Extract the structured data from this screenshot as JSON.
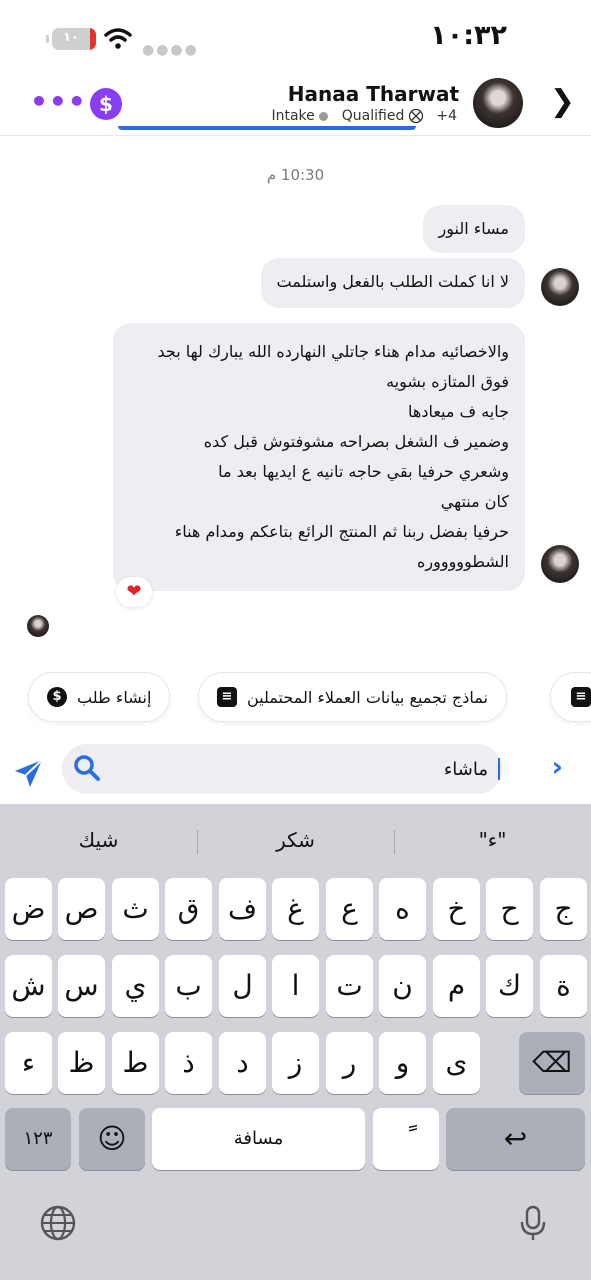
{
  "status": {
    "time": "١٠:٣٢",
    "battery": "١٠"
  },
  "header": {
    "contact_name": "Hanaa Tharwat",
    "tags": [
      "Intake",
      "Qualified",
      "+4"
    ]
  },
  "chat": {
    "time_label": "10:30 م",
    "messages": [
      {
        "text": "مساء النور"
      },
      {
        "text": "لا انا كملت الطلب بالفعل واستلمت"
      },
      {
        "text": "والاخصائيه مدام هناء جاتلي النهارده الله يبارك لها بجد\nفوق المتازه بشويه\nجايه ف ميعادها\nوضمير ف الشغل بصراحه مشوفتوش قبل كده\nوشعري حرفيا بقي حاجه تانيه ع ايديها بعد ما\nكان منتهي\nحرفيا بفضل ربنا ثم المنتج الرائع بتاعكم ومدام هناء\nالشطوووووره"
      }
    ],
    "reaction": "❤"
  },
  "chips": {
    "create_order": "إنشاء طلب",
    "lead_forms": "نماذج تجميع بيانات العملاء المحتملين"
  },
  "composer": {
    "input_value": "ماشاء"
  },
  "keyboard": {
    "suggestions": [
      "شيك",
      "شكر",
      "\"ء\""
    ],
    "row1": [
      "ض",
      "ص",
      "ث",
      "ق",
      "ف",
      "غ",
      "ع",
      "ه",
      "خ",
      "ح",
      "ج"
    ],
    "row2": [
      "ش",
      "س",
      "ي",
      "ب",
      "ل",
      "ا",
      "ت",
      "ن",
      "م",
      "ك",
      "ة"
    ],
    "row3": [
      "ء",
      "ظ",
      "ط",
      "ذ",
      "د",
      "ز",
      "ر",
      "و",
      "ى"
    ],
    "numbers_key": "١٢٣",
    "emoji_key": "☺",
    "space_key": "مسافة",
    "diacritic_key": "ً",
    "return_key": "↩",
    "delete_key": "⌫"
  },
  "colors": {
    "accent_purple": "#8a3cf2",
    "accent_blue": "#2a6ce8",
    "bubble": "#eeeef2",
    "keyboard_bg": "#d1d3d9"
  }
}
